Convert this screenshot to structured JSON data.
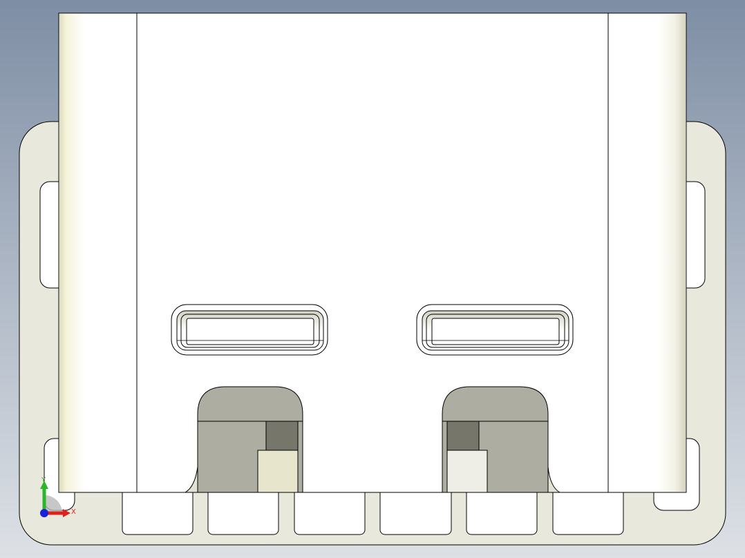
{
  "view": {
    "background_top": "#7e8ea4",
    "background_bottom": "#dde1e6",
    "part_face_color": "#ffffff",
    "part_side_color": "#e9e8dc",
    "part_edge_color": "#000000",
    "shaded_grey": "#adada2",
    "shaded_dark": "#76766b",
    "shaded_light": "#e7e5cc"
  },
  "triad": {
    "x_label": "X",
    "y_label": "Y",
    "x_color": "#e0201a",
    "y_color": "#2ab52a",
    "z_color": "#1a22d8"
  }
}
